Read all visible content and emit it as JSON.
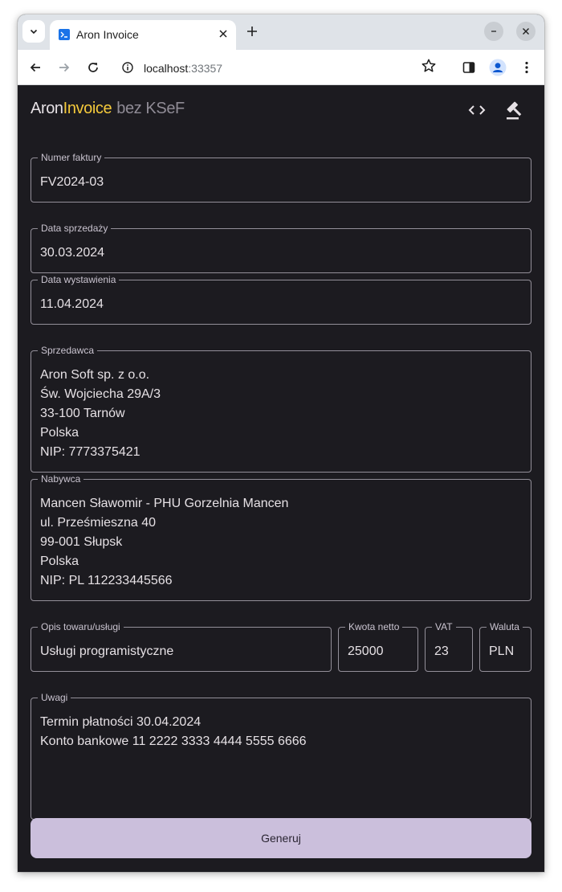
{
  "browser": {
    "tab_title": "Aron Invoice",
    "url_host": "localhost",
    "url_port": ":33357"
  },
  "app": {
    "brand_part1": "Aron",
    "brand_part2": "Invoice",
    "brand_suffix": "bez KSeF",
    "colors": {
      "background": "#1c1b20",
      "accent_yellow": "#f4c93b",
      "button": "#cbbfdc"
    }
  },
  "form": {
    "invoice_number": {
      "label": "Numer faktury",
      "value": "FV2024-03"
    },
    "sale_date": {
      "label": "Data sprzedaży",
      "value": "30.03.2024"
    },
    "issue_date": {
      "label": "Data wystawienia",
      "value": "11.04.2024"
    },
    "seller": {
      "label": "Sprzedawca",
      "value": "Aron Soft sp. z o.o.\nŚw. Wojciecha 29A/3\n33-100 Tarnów\nPolska\nNIP: 7773375421"
    },
    "buyer": {
      "label": "Nabywca",
      "value": "Mancen Sławomir - PHU Gorzelnia Mancen\nul. Prześmieszna 40\n99-001 Słupsk\nPolska\nNIP: PL 112233445566"
    },
    "description": {
      "label": "Opis towaru/usługi",
      "value": "Usługi programistyczne"
    },
    "net_amount": {
      "label": "Kwota netto",
      "value": "25000"
    },
    "vat": {
      "label": "VAT",
      "value": "23"
    },
    "currency": {
      "label": "Waluta",
      "value": "PLN"
    },
    "notes": {
      "label": "Uwagi",
      "value": "Termin płatności 30.04.2024\nKonto bankowe 11 2222 3333 4444 5555 6666"
    },
    "generate_label": "Generuj"
  }
}
